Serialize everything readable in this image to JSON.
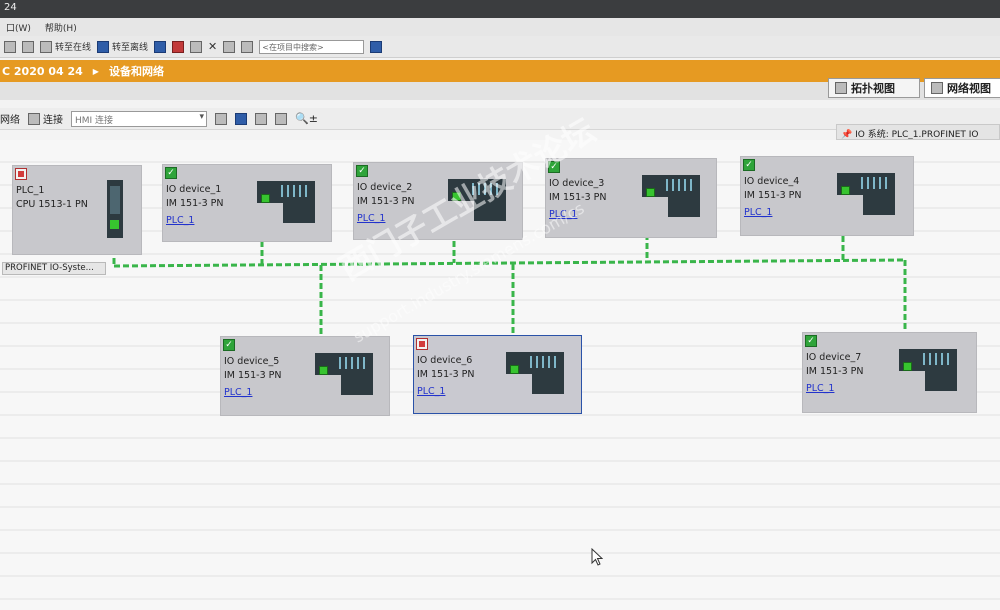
{
  "window": {
    "title_fragment": "24"
  },
  "menu": {
    "items": [
      "口(W)",
      "帮助(H)"
    ]
  },
  "toolbar": {
    "go_online": "转至在线",
    "go_offline": "转至离线",
    "search_placeholder": "<在项目中搜索>"
  },
  "breadcrumb": {
    "project": "C 2020 04 24",
    "section": "设备和网络"
  },
  "views": {
    "topology": "拓扑视图",
    "network": "网络视图"
  },
  "editor": {
    "network_btn": "网络",
    "connect_btn": "连接",
    "connection_type": "HMI 连接"
  },
  "io_system": {
    "label": "IO 系统: PLC_1.PROFINET IO"
  },
  "network_label": "PROFINET IO-Syste...",
  "devices": [
    {
      "name": "PLC_1",
      "type": "CPU 1513-1 PN",
      "link": "",
      "status": "warning"
    },
    {
      "name": "IO device_1",
      "type": "IM 151-3 PN",
      "link": "PLC_1",
      "status": "ok"
    },
    {
      "name": "IO device_2",
      "type": "IM 151-3 PN",
      "link": "PLC_1",
      "status": "ok"
    },
    {
      "name": "IO device_3",
      "type": "IM 151-3 PN",
      "link": "PLC_1",
      "status": "ok"
    },
    {
      "name": "IO device_4",
      "type": "IM 151-3 PN",
      "link": "PLC_1",
      "status": "ok"
    },
    {
      "name": "IO device_5",
      "type": "IM 151-3 PN",
      "link": "PLC_1",
      "status": "ok"
    },
    {
      "name": "IO device_6",
      "type": "IM 151-3 PN",
      "link": "PLC_1",
      "status": "warning"
    },
    {
      "name": "IO device_7",
      "type": "IM 151-3 PN",
      "link": "PLC_1",
      "status": "ok"
    }
  ],
  "watermark": {
    "line1": "西门子工业技术论坛",
    "line2": "support.industry.siemens.com/cs"
  },
  "colors": {
    "accent": "#e69a22",
    "network_line": "#39b54a",
    "selected_border": "#2a52a8"
  }
}
